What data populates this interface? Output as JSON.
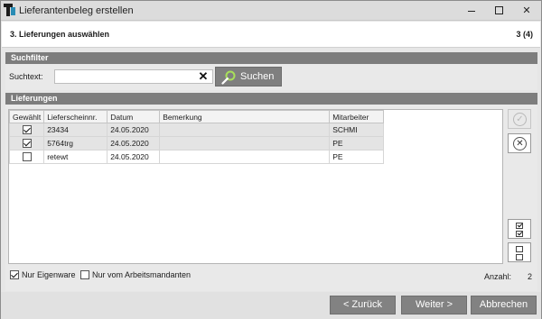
{
  "window": {
    "title": "Lieferantenbeleg erstellen"
  },
  "step": {
    "title": "3.  Lieferungen auswählen",
    "counter": "3 (4)"
  },
  "search": {
    "section_title": "Suchfilter",
    "label": "Suchtext:",
    "value": "",
    "button_label": "Suchen"
  },
  "deliveries": {
    "section_title": "Lieferungen",
    "columns": [
      "Gewählt",
      "Lieferscheinnr.",
      "Datum",
      "Bemerkung",
      "Mitarbeiter"
    ],
    "rows": [
      {
        "selected": true,
        "number": "23434",
        "date": "24.05.2020",
        "remark": "",
        "employee": "SCHMI"
      },
      {
        "selected": true,
        "number": "5764trg",
        "date": "24.05.2020",
        "remark": "",
        "employee": "PE"
      },
      {
        "selected": false,
        "number": "retewt",
        "date": "24.05.2020",
        "remark": "",
        "employee": "PE"
      }
    ],
    "options": {
      "own_goods": {
        "label": "Nur Eigenware",
        "checked": true
      },
      "work_clients": {
        "label": "Nur vom Arbeitsmandanten",
        "checked": false
      }
    },
    "count_label": "Anzahl:",
    "count_value": "2"
  },
  "footer": {
    "back_label": "< Zurück",
    "next_label": "Weiter >",
    "cancel_label": "Abbrechen"
  },
  "colors": {
    "section_header": "#7d7d7d",
    "button": "#828282",
    "accent": "#2a8cb5"
  }
}
